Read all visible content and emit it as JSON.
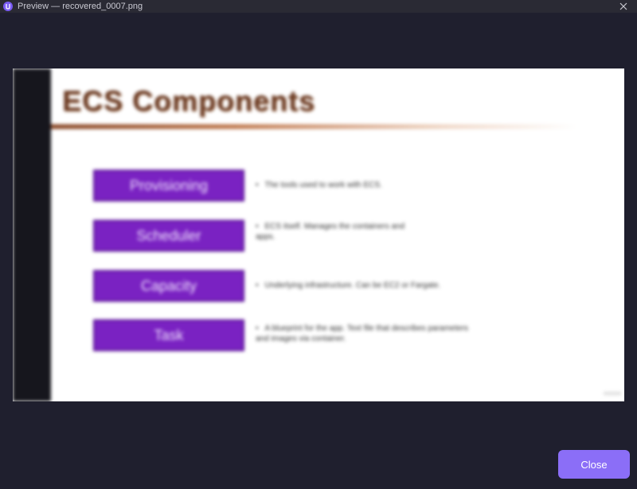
{
  "window": {
    "title": "Preview — recovered_0007.png",
    "close_icon": "close-icon",
    "app_icon": "app-logo-icon"
  },
  "slide": {
    "title": "ECS Components",
    "components": [
      {
        "label": "Provisioning",
        "description": "The tools used to work with ECS."
      },
      {
        "label": "Scheduler",
        "description": "ECS itself. Manages the containers and apps."
      },
      {
        "label": "Capacity",
        "description": "Underlying infrastructure. Can be EC2 or Fargate."
      },
      {
        "label": "Task",
        "description": "A blueprint for the app. Text file that describes parameters and images via container."
      }
    ],
    "accent_color": "#7a22c2",
    "title_color": "#6b3a22"
  },
  "footer": {
    "close_label": "Close",
    "close_color": "#8b6ef7"
  }
}
